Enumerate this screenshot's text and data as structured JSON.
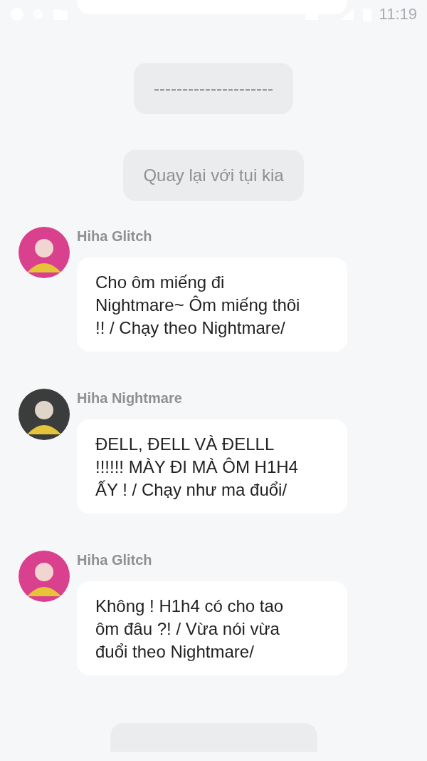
{
  "status_bar": {
    "time": "11:19"
  },
  "items": [
    {
      "kind": "bubble_edge"
    },
    {
      "kind": "pill",
      "text": "---------------------"
    },
    {
      "kind": "pill",
      "text": "Quay lại với tụi kia"
    },
    {
      "kind": "message",
      "sender": "Hiha Glitch",
      "color": "#d9418f",
      "text": "Cho ôm miếng đi Nightmare~ Ôm miếng thôi !! / Chạy theo Nightmare/"
    },
    {
      "kind": "message",
      "sender": "Hiha Nightmare",
      "color": "#3a3d3c",
      "text": "ĐELL, ĐELL VÀ ĐELLL !!!!!! MÀY ĐI MÀ ÔM H1H4 ẤY ! / Chạy như ma đuổi/"
    },
    {
      "kind": "message",
      "sender": "Hiha Glitch",
      "color": "#d9418f",
      "text": "Không ! H1h4 có cho tao ôm đâu ?! / Vừa nói vừa đuổi theo Nightmare/"
    },
    {
      "kind": "pill_edge"
    }
  ]
}
